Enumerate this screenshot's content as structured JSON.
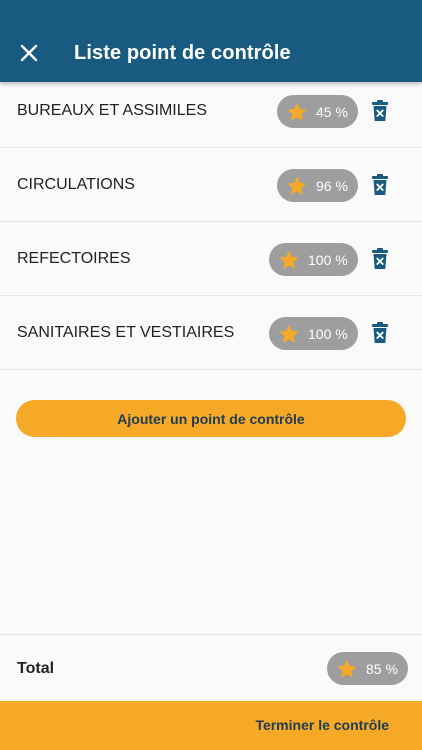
{
  "appbar": {
    "title": "Liste point de contrôle",
    "close_icon": "close-icon"
  },
  "items": [
    {
      "label": "BUREAUX ET ASSIMILES",
      "score": "45 %"
    },
    {
      "label": "CIRCULATIONS",
      "score": "96 %"
    },
    {
      "label": "REFECTOIRES",
      "score": "100 %"
    },
    {
      "label": "SANITAIRES ET VESTIAIRES",
      "score": "100 %"
    }
  ],
  "add_button": {
    "label": "Ajouter un point de contrôle"
  },
  "total": {
    "label": "Total",
    "score": "85 %"
  },
  "footer": {
    "finish_label": "Terminer le contrôle"
  },
  "colors": {
    "primary": "#185a80",
    "accent": "#f5a927",
    "pill": "#9e9e9e",
    "star": "#f5a927",
    "button_text": "#1f3c55"
  }
}
